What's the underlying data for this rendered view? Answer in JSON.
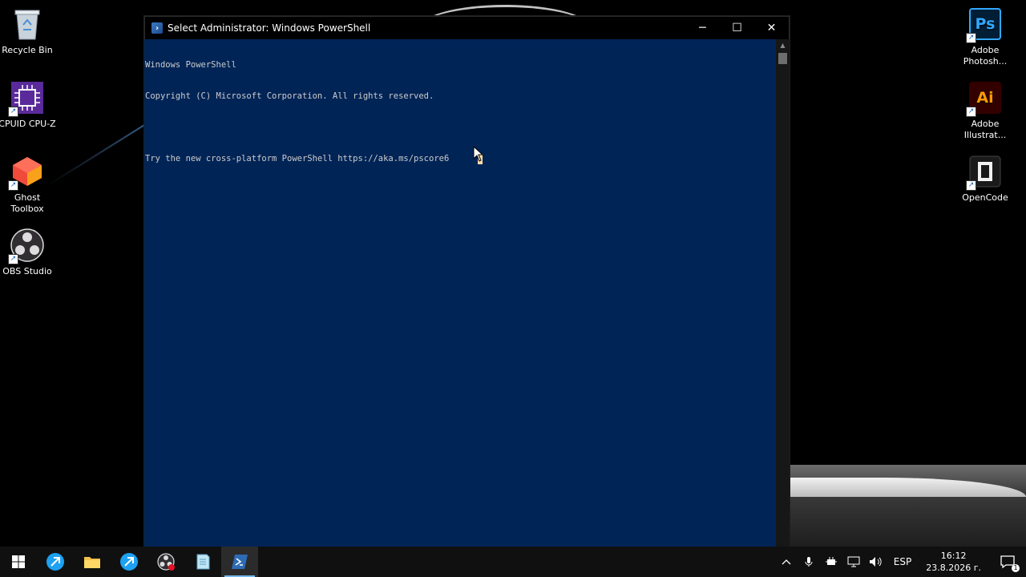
{
  "desktop": {
    "icons_left": [
      {
        "label": "Recycle Bin",
        "icon": "recycle-bin-icon"
      },
      {
        "label": "CPUID CPU-Z",
        "icon": "cpu-z-icon"
      },
      {
        "label": "Ghost Toolbox",
        "icon": "ghost-toolbox-icon"
      },
      {
        "label": "OBS Studio",
        "icon": "obs-studio-icon"
      }
    ],
    "icons_right": [
      {
        "label": "Adobe Photosh...",
        "icon": "photoshop-icon",
        "glyph": "Ps",
        "color": "#31a8ff",
        "bg": "#001e36"
      },
      {
        "label": "Adobe Illustrat...",
        "icon": "illustrator-icon",
        "glyph": "Ai",
        "color": "#ff9a00",
        "bg": "#330000"
      },
      {
        "label": "OpenCode",
        "icon": "opencode-icon"
      }
    ]
  },
  "window": {
    "title": "Select Administrator: Windows PowerShell",
    "background": "#012456",
    "console_lines": [
      "Windows PowerShell",
      "Copyright (C) Microsoft Corporation. All rights reserved.",
      "",
      "Try the new cross-platform PowerShell https://aka.ms/pscore6"
    ],
    "controls": {
      "minimize": "─",
      "maximize": "☐",
      "close": "✕"
    }
  },
  "taskbar": {
    "apps": [
      {
        "name": "start-button",
        "icon": "windows-logo-icon"
      },
      {
        "name": "browser-app",
        "icon": "browser-icon"
      },
      {
        "name": "file-explorer-app",
        "icon": "folder-icon"
      },
      {
        "name": "browser-app-2",
        "icon": "browser-icon"
      },
      {
        "name": "obs-app",
        "icon": "obs-icon"
      },
      {
        "name": "notepad-app",
        "icon": "notepad-icon"
      },
      {
        "name": "powershell-app",
        "icon": "powershell-icon",
        "active": true
      }
    ],
    "tray": {
      "language": "ESP",
      "time": "16:12",
      "date": "23.8.2026 г.",
      "notification_count": "1"
    }
  }
}
